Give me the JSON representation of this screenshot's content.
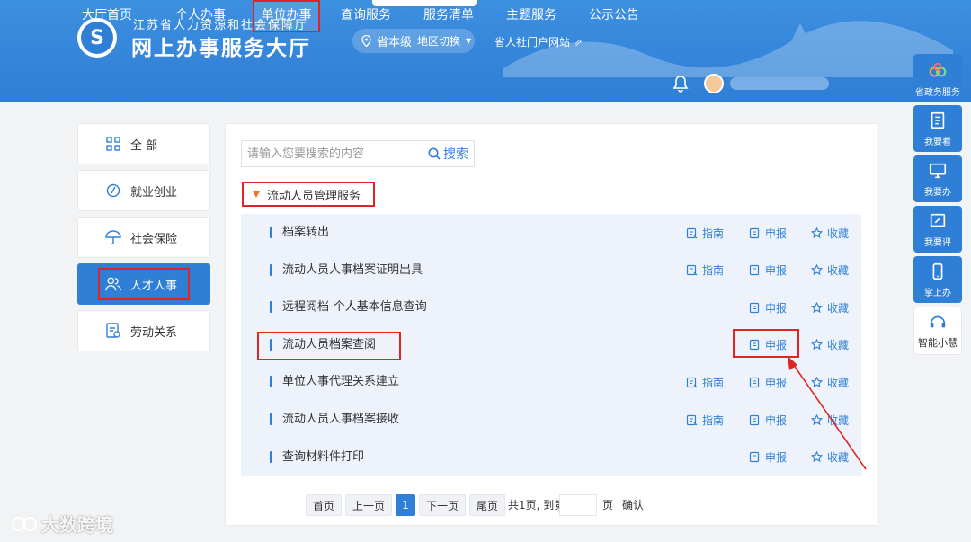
{
  "header": {
    "org_sub": "江苏省人力资源和社会保障厅",
    "org_main": "网上办事服务大厅",
    "level": "省本级",
    "region_switch": "地区切换",
    "portal_link": "省人社门户网站"
  },
  "nav": [
    {
      "label": "大厅首页"
    },
    {
      "label": "个人办事"
    },
    {
      "label": "单位办事"
    },
    {
      "label": "查询服务"
    },
    {
      "label": "服务清单"
    },
    {
      "label": "主题服务"
    },
    {
      "label": "公示公告"
    }
  ],
  "categories": [
    {
      "label": "全 部",
      "icon": "grid-icon"
    },
    {
      "label": "就业创业",
      "icon": "employment-icon"
    },
    {
      "label": "社会保险",
      "icon": "umbrella-icon"
    },
    {
      "label": "人才人事",
      "icon": "people-icon"
    },
    {
      "label": "劳动关系",
      "icon": "document-icon"
    }
  ],
  "search": {
    "placeholder": "请输入您要搜索的内容",
    "button": "搜索"
  },
  "group": {
    "title": "流动人员管理服务"
  },
  "actions": {
    "guide": "指南",
    "apply": "申报",
    "favorite": "收藏"
  },
  "services": [
    {
      "name": "档案转出",
      "has_guide": true
    },
    {
      "name": "流动人员人事档案证明出具",
      "has_guide": true
    },
    {
      "name": "远程阅档-个人基本信息查询",
      "has_guide": false
    },
    {
      "name": "流动人员档案查阅",
      "has_guide": false
    },
    {
      "name": "单位人事代理关系建立",
      "has_guide": true
    },
    {
      "name": "流动人员人事档案接收",
      "has_guide": true
    },
    {
      "name": "查询材料件打印",
      "has_guide": false
    }
  ],
  "pagination": {
    "first": "首页",
    "prev": "上一页",
    "current": "1",
    "next": "下一页",
    "last": "尾页",
    "summary": "共1页, 到第",
    "page_unit": "页",
    "confirm": "确认"
  },
  "float_bar": [
    {
      "label": "省政务服务"
    },
    {
      "label": "我要看"
    },
    {
      "label": "我要办"
    },
    {
      "label": "我要评"
    },
    {
      "label": "掌上办"
    },
    {
      "label": "智能小慧"
    }
  ],
  "watermark": "大数跨境",
  "colors": {
    "primary": "#2f7fd6",
    "highlight": "#e02424",
    "accent": "#e8792d"
  }
}
